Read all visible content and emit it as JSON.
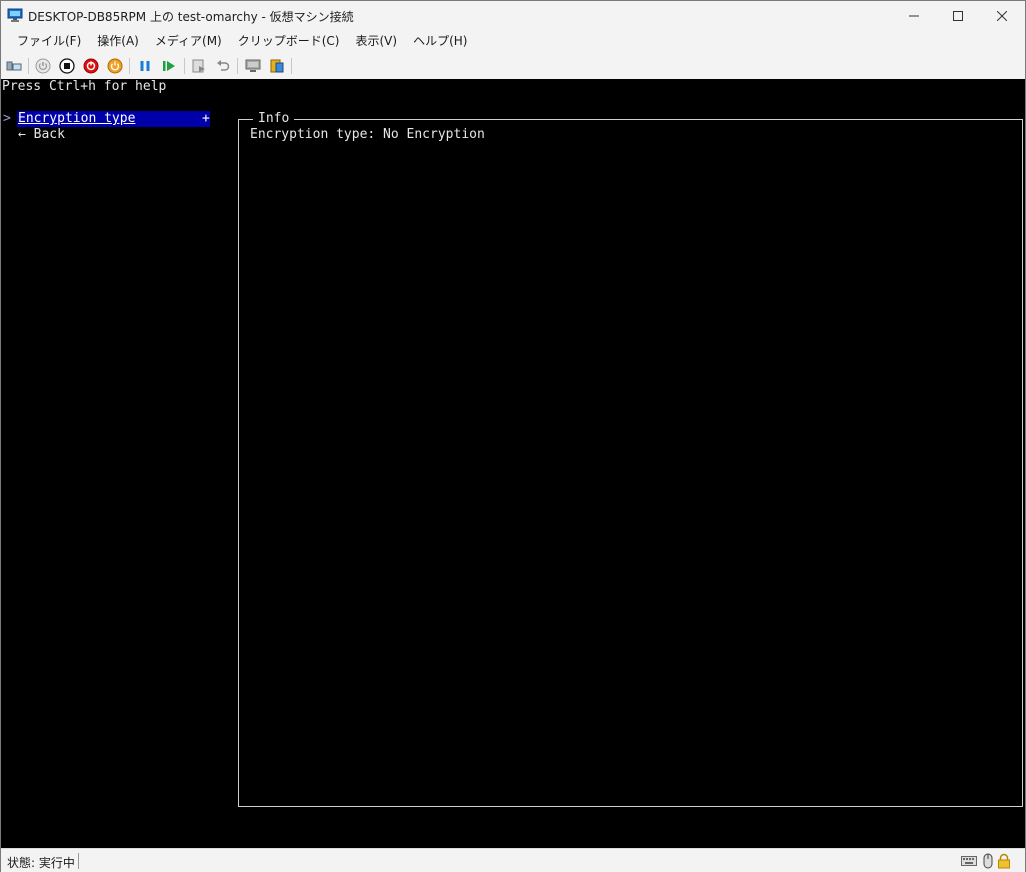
{
  "window": {
    "title": "DESKTOP-DB85RPM 上の test-omarchy - 仮想マシン接続"
  },
  "menu": [
    {
      "label": "ファイル(F)"
    },
    {
      "label": "操作(A)"
    },
    {
      "label": "メディア(M)"
    },
    {
      "label": "クリップボード(C)"
    },
    {
      "label": "表示(V)"
    },
    {
      "label": "ヘルプ(H)"
    }
  ],
  "toolbar": {
    "icons": [
      "ctrl-alt-del-icon",
      "start-icon",
      "turn-off-icon",
      "shut-down-icon",
      "save-state-icon",
      "pause-icon",
      "resume-icon",
      "checkpoint-icon",
      "revert-icon",
      "enhanced-session-icon",
      "share-icon"
    ]
  },
  "console": {
    "help_line": "Press Ctrl+h for help",
    "cursor": ">",
    "selected_item": "Encryption type",
    "selected_marker": "+",
    "back_item": "← Back",
    "info_title": "Info",
    "info_text": "Encryption type: No Encryption"
  },
  "status": {
    "text": "状態: 実行中"
  },
  "colors": {
    "selection": "#0000aa",
    "console_bg": "#000000",
    "chrome_bg": "#f3f3f3"
  }
}
